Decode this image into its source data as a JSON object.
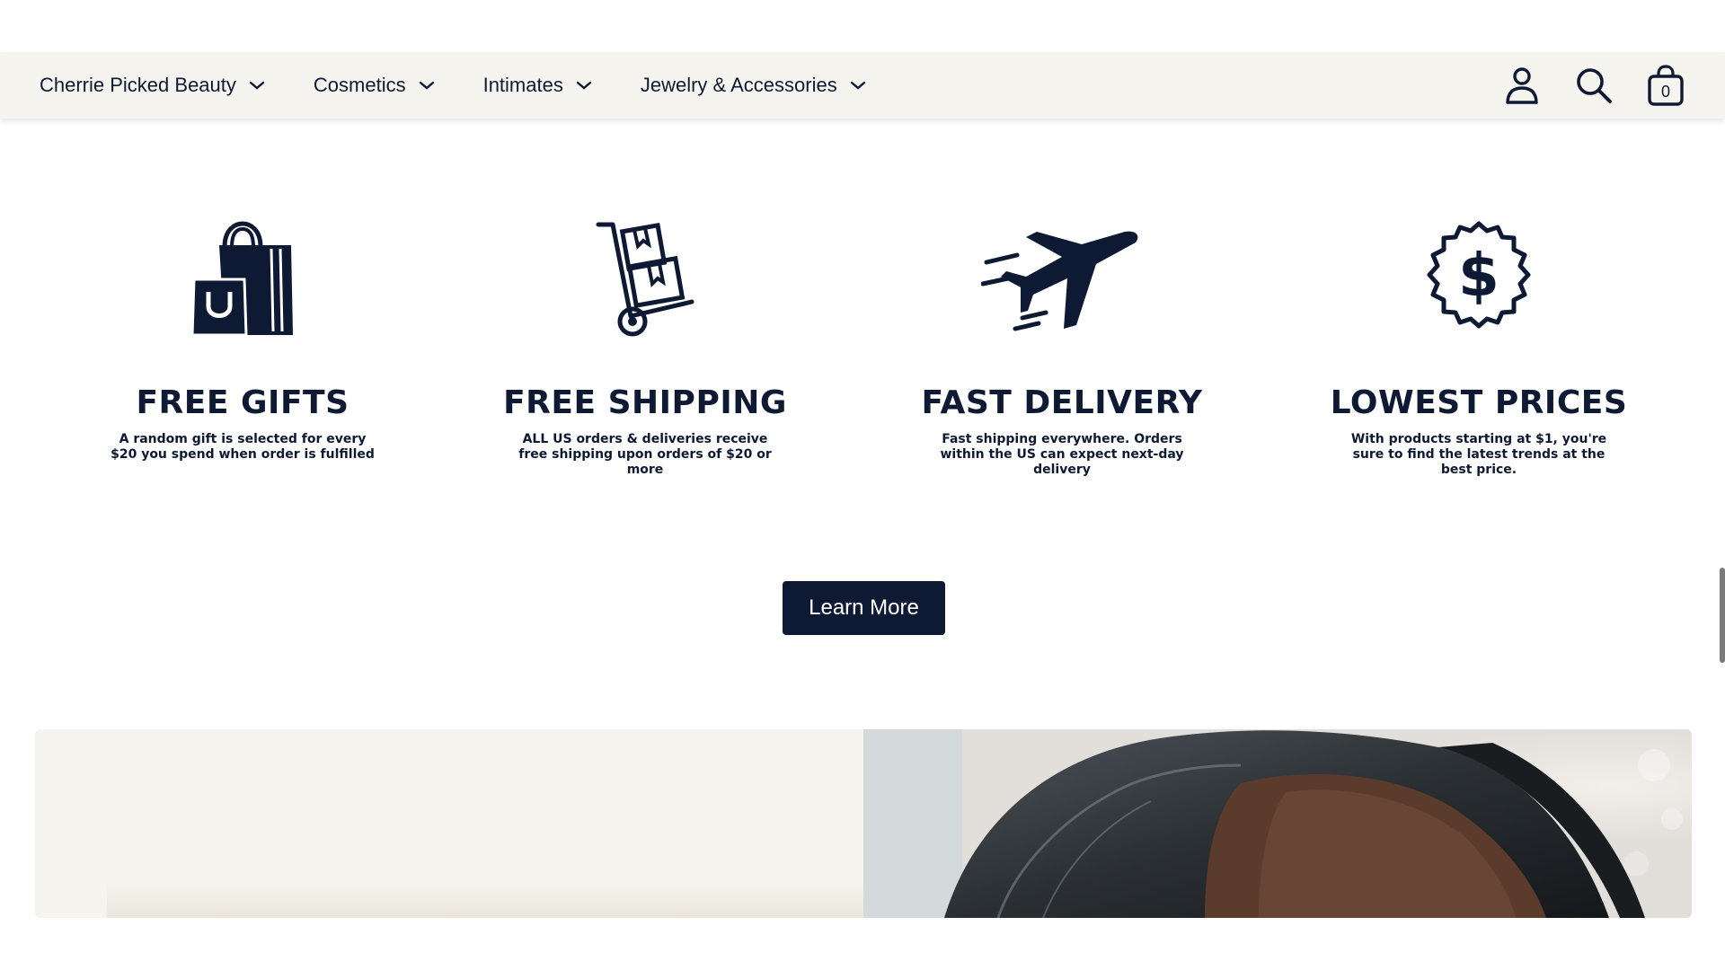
{
  "nav": {
    "items": [
      {
        "label": "Cherrie Picked Beauty"
      },
      {
        "label": "Cosmetics"
      },
      {
        "label": "Intimates"
      },
      {
        "label": "Jewelry & Accessories"
      }
    ]
  },
  "header": {
    "account_icon": "person-icon",
    "search_icon": "search-icon",
    "cart_icon": "shopping-bag-icon",
    "cart_count": "0"
  },
  "features": [
    {
      "icon": "shopping-bags-icon",
      "title": "FREE GIFTS",
      "text": "A random gift is selected for every $20 you spend when order is fulfilled"
    },
    {
      "icon": "hand-truck-boxes-icon",
      "title": "FREE SHIPPING",
      "text": "ALL US orders & deliveries receive free shipping upon orders of $20 or more"
    },
    {
      "icon": "airplane-icon",
      "title": "FAST DELIVERY",
      "text": "Fast shipping everywhere. Orders within the US can expect next-day delivery"
    },
    {
      "icon": "dollar-badge-icon",
      "title": "LOWEST PRICES",
      "text": "With products starting at $1, you're sure to find the latest trends at the best price."
    }
  ],
  "cta": {
    "label": "Learn More"
  },
  "colors": {
    "navy": "#0e1a33",
    "cream": "#f6f4ee",
    "white": "#ffffff"
  }
}
